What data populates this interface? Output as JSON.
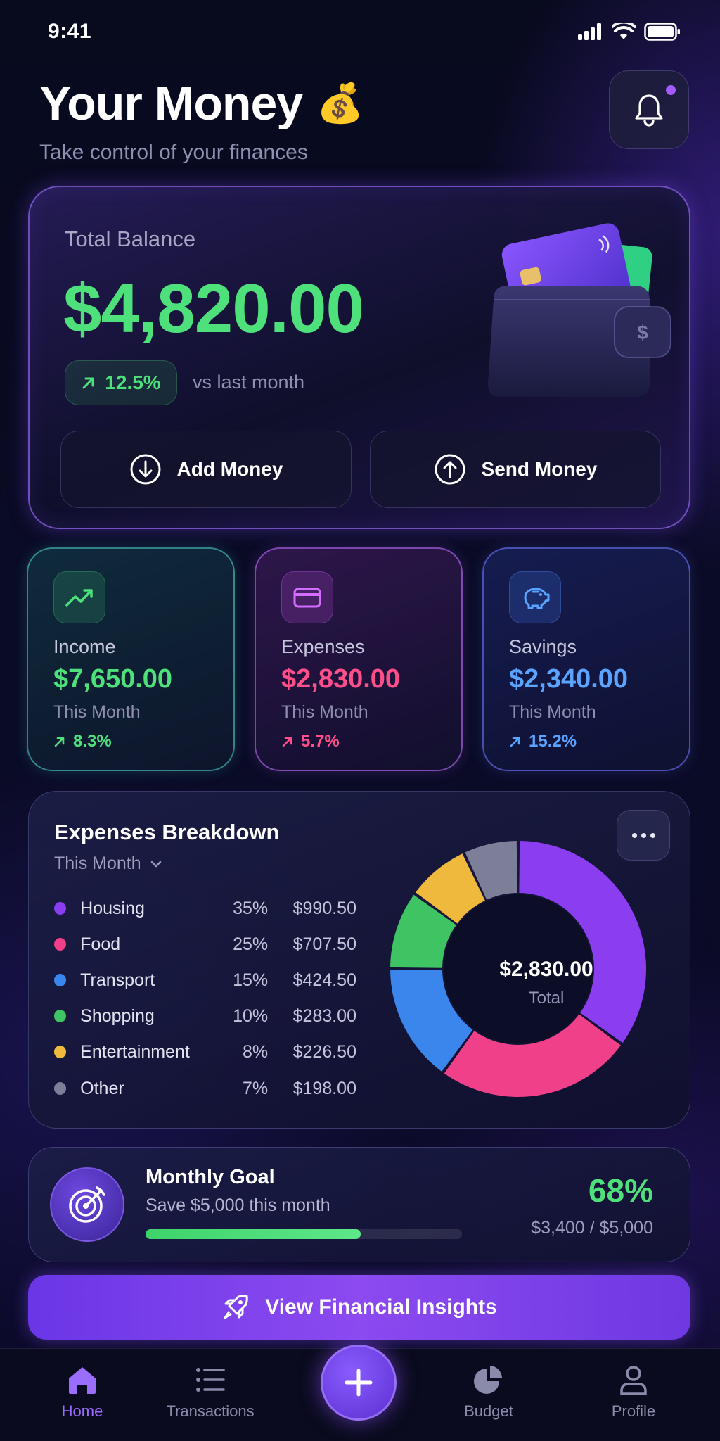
{
  "status_bar": {
    "time": "9:41"
  },
  "header": {
    "title": "Your Money",
    "emoji": "💰",
    "subtitle": "Take control of your finances"
  },
  "balance": {
    "label": "Total Balance",
    "amount": "$4,820.00",
    "change": "12.5%",
    "change_note": "vs last month",
    "add_label": "Add Money",
    "send_label": "Send Money"
  },
  "stats": [
    {
      "label": "Income",
      "value": "$7,650.00",
      "period": "This Month",
      "change": "8.3%",
      "color": "#4ee07a",
      "icon": "trend-up-icon"
    },
    {
      "label": "Expenses",
      "value": "$2,830.00",
      "period": "This Month",
      "change": "5.7%",
      "color": "#ff4f8b",
      "icon": "card-icon"
    },
    {
      "label": "Savings",
      "value": "$2,340.00",
      "period": "This Month",
      "change": "15.2%",
      "color": "#5aa3ff",
      "icon": "piggy-bank-icon"
    }
  ],
  "breakdown": {
    "title": "Expenses Breakdown",
    "period": "This Month",
    "total": "$2,830.00",
    "total_label": "Total",
    "categories": [
      {
        "name": "Housing",
        "pct": "35%",
        "amount": "$990.50",
        "share": 35,
        "color": "#8b3df0"
      },
      {
        "name": "Food",
        "pct": "25%",
        "amount": "$707.50",
        "share": 25,
        "color": "#f0408a"
      },
      {
        "name": "Transport",
        "pct": "15%",
        "amount": "$424.50",
        "share": 15,
        "color": "#3a86ec"
      },
      {
        "name": "Shopping",
        "pct": "10%",
        "amount": "$283.00",
        "share": 10,
        "color": "#3fc463"
      },
      {
        "name": "Entertainment",
        "pct": "8%",
        "amount": "$226.50",
        "share": 8,
        "color": "#efb93e"
      },
      {
        "name": "Other",
        "pct": "7%",
        "amount": "$198.00",
        "share": 7,
        "color": "#7d7f99"
      }
    ]
  },
  "goal": {
    "title": "Monthly Goal",
    "subtitle": "Save $5,000 this month",
    "percent_label": "68%",
    "progress_label": "$3,400 / $5,000",
    "progress": 0.68
  },
  "insights": {
    "label": "View Financial Insights"
  },
  "tabbar": {
    "home": "Home",
    "transactions": "Transactions",
    "budget": "Budget",
    "profile": "Profile"
  },
  "colors": {
    "accent": "#8b4cf5",
    "positive": "#4ee07a",
    "negative": "#ff4f8b",
    "savings": "#5aa3ff"
  }
}
